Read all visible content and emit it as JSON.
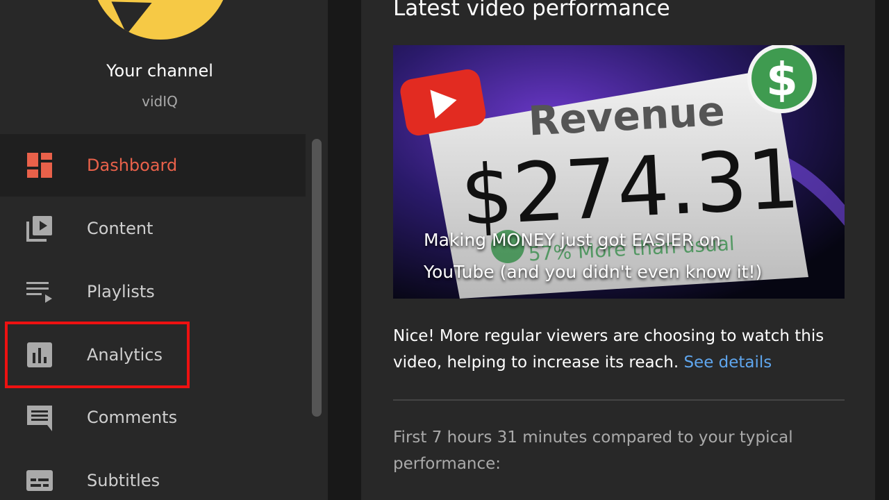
{
  "channel": {
    "name": "Your channel",
    "handle": "vidIQ"
  },
  "nav": {
    "items": [
      {
        "label": "Dashboard",
        "icon": "dashboard-icon",
        "active": true
      },
      {
        "label": "Content",
        "icon": "content-icon"
      },
      {
        "label": "Playlists",
        "icon": "playlists-icon"
      },
      {
        "label": "Analytics",
        "icon": "analytics-icon"
      },
      {
        "label": "Comments",
        "icon": "comments-icon"
      },
      {
        "label": "Subtitles",
        "icon": "subtitles-icon"
      }
    ]
  },
  "latest_video": {
    "section_title": "Latest video performance",
    "thumbnail": {
      "sign_title": "Revenue",
      "amount": "$274.31",
      "badge_text": "57% More than usual",
      "dollar_symbol": "$"
    },
    "caption_line1": "Making MONEY just got EASIER on",
    "caption_line2": "YouTube (and you didn't even know it!)",
    "message": "Nice! More regular viewers are choosing to watch this video, helping to increase its reach.",
    "link_label": "See details",
    "performance_note": "First 7 hours 31 minutes compared to your typical performance:"
  },
  "colors": {
    "active": "#e9614a",
    "link": "#5fa6ee",
    "highlight": "#ee1111",
    "avatar": "#f6c945"
  }
}
